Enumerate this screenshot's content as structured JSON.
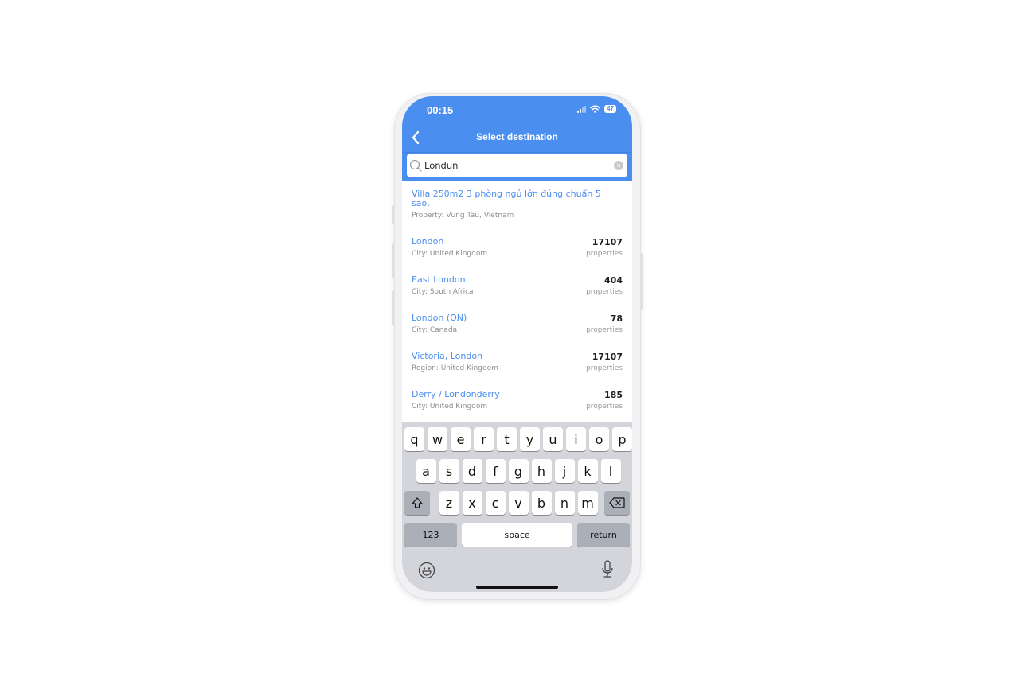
{
  "status_bar": {
    "time": "00:15",
    "battery": "47"
  },
  "header": {
    "title": "Select destination"
  },
  "search": {
    "value": "Londun",
    "placeholder": ""
  },
  "results": [
    {
      "name": "Villa 250m2  3 phòng ngủ lớn đúng chuẩn 5 sao,",
      "subtitle": "Property: Vũng Tàu, Vietnam",
      "count": "",
      "unit": ""
    },
    {
      "name": "London",
      "subtitle": "City: United Kingdom",
      "count": "17107",
      "unit": "properties"
    },
    {
      "name": "East London",
      "subtitle": "City: South Africa",
      "count": "404",
      "unit": "properties"
    },
    {
      "name": "London (ON)",
      "subtitle": "City: Canada",
      "count": "78",
      "unit": "properties"
    },
    {
      "name": "Victoria, London",
      "subtitle": "Region: United Kingdom",
      "count": "17107",
      "unit": "properties"
    },
    {
      "name": "Derry / Londonderry",
      "subtitle": "City: United Kingdom",
      "count": "185",
      "unit": "properties"
    }
  ],
  "keyboard": {
    "row1": [
      "q",
      "w",
      "e",
      "r",
      "t",
      "y",
      "u",
      "i",
      "o",
      "p"
    ],
    "row2": [
      "a",
      "s",
      "d",
      "f",
      "g",
      "h",
      "j",
      "k",
      "l"
    ],
    "row3": [
      "z",
      "x",
      "c",
      "v",
      "b",
      "n",
      "m"
    ],
    "numbers_label": "123",
    "space_label": "space",
    "return_label": "return"
  },
  "colors": {
    "accent": "#4a8ef0",
    "keyboard_bg": "#d3d5db"
  }
}
